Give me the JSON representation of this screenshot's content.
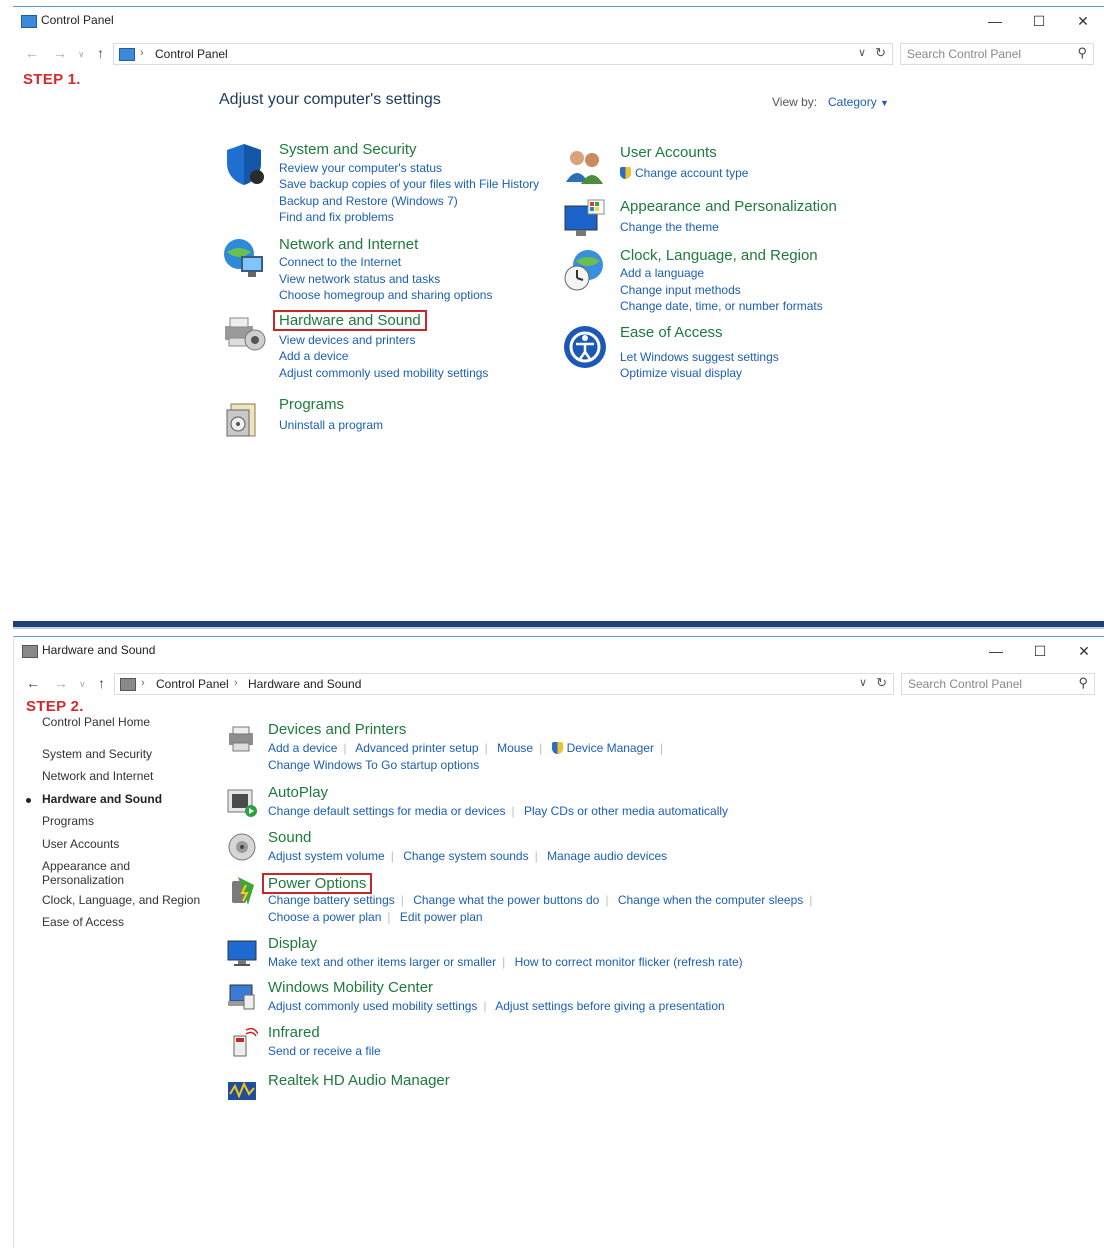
{
  "screen1": {
    "window_title": "Control Panel",
    "breadcrumb": [
      "Control Panel"
    ],
    "search_placeholder": "Search Control Panel",
    "step_label": "STEP 1.",
    "heading": "Adjust your computer's settings",
    "view_by_label": "View by:",
    "view_by_value": "Category",
    "categories_left": [
      {
        "title": "System and Security",
        "icon": "shield-icon",
        "links": [
          "Review your computer's status",
          "Save backup copies of your files with File History",
          "Backup and Restore (Windows 7)",
          "Find and fix problems"
        ]
      },
      {
        "title": "Network and Internet",
        "icon": "globe-network-icon",
        "links": [
          "Connect to the Internet",
          "View network status and tasks",
          "Choose homegroup and sharing options"
        ]
      },
      {
        "title": "Hardware and Sound",
        "icon": "printer-speaker-icon",
        "links": [
          "View devices and printers",
          "Add a device",
          "Adjust commonly used mobility settings"
        ]
      },
      {
        "title": "Programs",
        "icon": "programs-icon",
        "links": [
          "Uninstall a program"
        ]
      }
    ],
    "categories_right": [
      {
        "title": "User Accounts",
        "icon": "users-icon",
        "links": [
          "Change account type"
        ]
      },
      {
        "title": "Appearance and Personalization",
        "icon": "monitor-palette-icon",
        "links": [
          "Change the theme"
        ]
      },
      {
        "title": "Clock, Language, and Region",
        "icon": "clock-globe-icon",
        "links": [
          "Add a language",
          "Change input methods",
          "Change date, time, or number formats"
        ]
      },
      {
        "title": "Ease of Access",
        "icon": "ease-of-access-icon",
        "links": [
          "Let Windows suggest settings",
          "Optimize visual display"
        ]
      }
    ]
  },
  "screen2": {
    "window_title": "Hardware and Sound",
    "breadcrumb": [
      "Control Panel",
      "Hardware and Sound"
    ],
    "search_placeholder": "Search Control Panel",
    "step_label": "STEP 2.",
    "left_nav": [
      "Control Panel Home",
      "System and Security",
      "Network and Internet",
      "Hardware and Sound",
      "Programs",
      "User Accounts",
      "Appearance and Personalization",
      "Clock, Language, and Region",
      "Ease of Access"
    ],
    "sections": [
      {
        "title": "Devices and Printers",
        "icon": "printer-icon",
        "links": [
          "Add a device",
          "Advanced printer setup",
          "Mouse",
          "Device Manager"
        ],
        "links2": [
          "Change Windows To Go startup options"
        ]
      },
      {
        "title": "AutoPlay",
        "icon": "autoplay-icon",
        "links": [
          "Change default settings for media or devices",
          "Play CDs or other media automatically"
        ]
      },
      {
        "title": "Sound",
        "icon": "speaker-icon",
        "links": [
          "Adjust system volume",
          "Change system sounds",
          "Manage audio devices"
        ]
      },
      {
        "title": "Power Options",
        "icon": "power-options-icon",
        "links": [
          "Change battery settings",
          "Change what the power buttons do",
          "Change when the computer sleeps"
        ],
        "links2": [
          "Choose a power plan",
          "Edit power plan"
        ]
      },
      {
        "title": "Display",
        "icon": "display-icon",
        "links": [
          "Make text and other items larger or smaller",
          "How to correct monitor flicker (refresh rate)"
        ]
      },
      {
        "title": "Windows Mobility Center",
        "icon": "mobility-center-icon",
        "links": [
          "Adjust commonly used mobility settings",
          "Adjust settings before giving a presentation"
        ]
      },
      {
        "title": "Infrared",
        "icon": "infrared-icon",
        "links": [
          "Send or receive a file"
        ]
      },
      {
        "title": "Realtek HD Audio Manager",
        "icon": "realtek-audio-icon",
        "links": []
      }
    ]
  },
  "colors": {
    "link": "#1a5fb4",
    "category_title": "#1e7a3c",
    "step": "#d62a2a",
    "highlight_box": "#c62828"
  }
}
